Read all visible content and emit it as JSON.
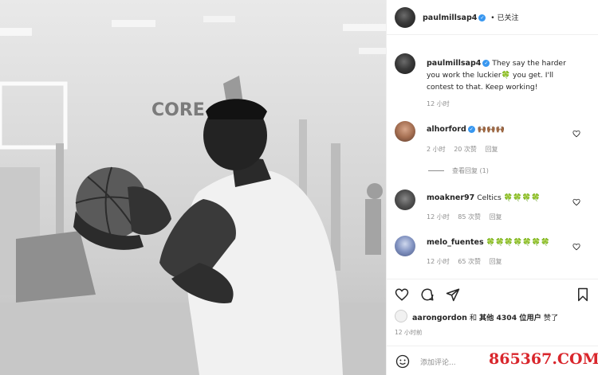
{
  "post": {
    "author": "paulmillsap4",
    "follow_status": "已关注",
    "caption": {
      "username": "paulmillsap4",
      "line1": "They say the harder",
      "line2": "you work the luckier🍀 you get. I'll",
      "line3": "contest to that. Keep working!",
      "time": "12 小时"
    },
    "comments": [
      {
        "username": "alhorford",
        "text": "🙌🏾🙌🏾🙌🏾",
        "time": "2 小时",
        "likes": "20 次赞",
        "reply": "回复",
        "view_replies": "查看回复 (1)"
      },
      {
        "username": "moakner97",
        "text": "Celtics 🍀🍀🍀🍀",
        "time": "12 小时",
        "likes": "85 次赞",
        "reply": "回复"
      },
      {
        "username": "melo_fuentes",
        "text": "🍀🍀🍀🍀🍀🍀🍀",
        "time": "12 小时",
        "likes": "65 次赞",
        "reply": "回复"
      }
    ],
    "likes_line": {
      "user": "aarongordon",
      "and": "和",
      "others": "其他 4304 位用户",
      "liked": "赞了"
    },
    "post_time": "12 小时前",
    "add_comment_placeholder": "添加评论...",
    "watermark": "865367.COM"
  },
  "icons": [
    "heart-icon",
    "comment-icon",
    "share-icon",
    "bookmark-icon",
    "emoji-icon",
    "verified-icon"
  ],
  "colors": {
    "verified": "#3897f0",
    "meta": "#8e8e8e",
    "watermark": "#d9262c"
  }
}
